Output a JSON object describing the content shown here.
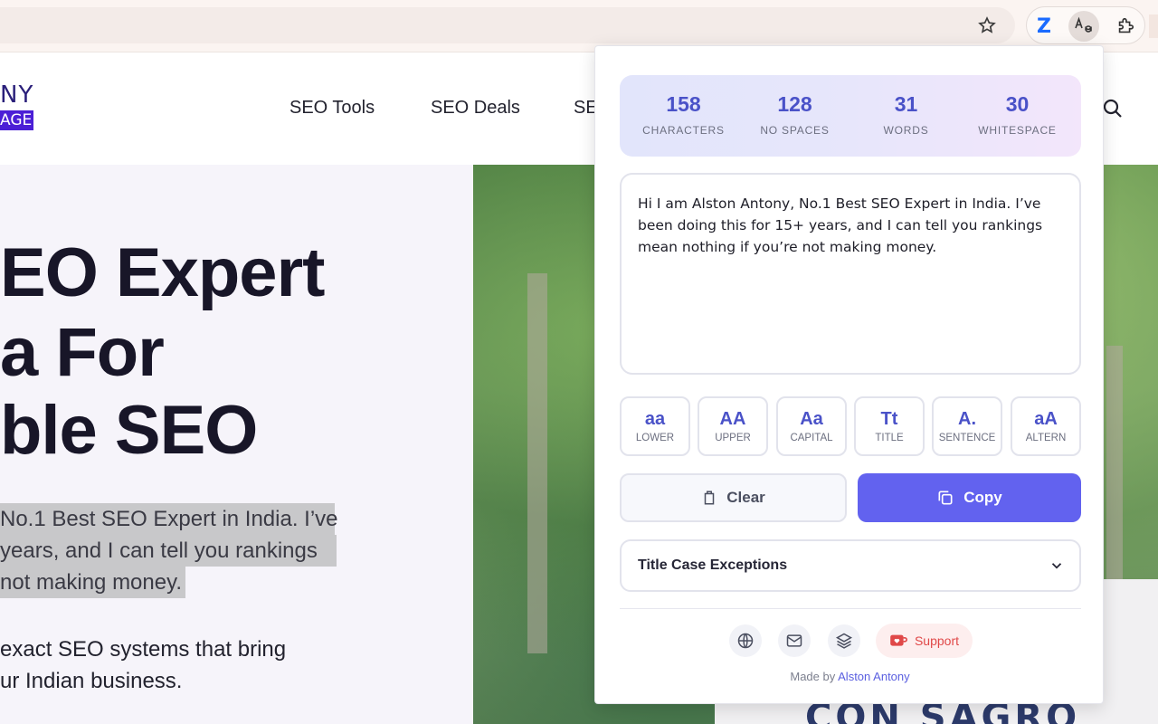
{
  "browser": {
    "star_icon": "star-icon",
    "extensions": [
      {
        "name": "zotero-extension",
        "glyph": "Z"
      },
      {
        "name": "case-converter-extension",
        "glyph": "Aa"
      },
      {
        "name": "extensions-puzzle",
        "glyph": "puzzle"
      }
    ]
  },
  "site": {
    "logo_top": "NY",
    "logo_badge": "AGE",
    "nav": [
      "SEO Tools",
      "SEO Deals",
      "SE"
    ],
    "hero_title": [
      "EO Expert",
      "a For",
      "ble SEO"
    ],
    "hero_selected_lines": [
      "No.1 Best SEO Expert in India. I’ve",
      "years, and I can tell you rankings",
      "not making money."
    ],
    "hero_body_lines": [
      "exact SEO systems that bring",
      "ur Indian business."
    ],
    "shirt_print": "CON SAGRO"
  },
  "popup": {
    "stats": [
      {
        "value": "158",
        "label": "CHARACTERS"
      },
      {
        "value": "128",
        "label": "NO SPACES"
      },
      {
        "value": "31",
        "label": "WORDS"
      },
      {
        "value": "30",
        "label": "WHITESPACE"
      }
    ],
    "text": "Hi I am Alston Antony, No.1 Best SEO Expert in India. I’ve been doing this for 15+ years, and I can tell you rankings mean nothing if you’re not making money.",
    "case_buttons": [
      {
        "glyph": "aa",
        "label": "LOWER"
      },
      {
        "glyph": "AA",
        "label": "UPPER"
      },
      {
        "glyph": "Aa",
        "label": "CAPITAL"
      },
      {
        "glyph": "Tt",
        "label": "TITLE"
      },
      {
        "glyph": "A.",
        "label": "SENTENCE"
      },
      {
        "glyph": "aA",
        "label": "ALTERN"
      }
    ],
    "clear_label": "Clear",
    "copy_label": "Copy",
    "exceptions_label": "Title Case Exceptions",
    "support_label": "Support",
    "made_by_prefix": "Made by",
    "made_by_name": "Alston Antony",
    "colors": {
      "accent": "#6262ef",
      "stat_value": "#4a52c8",
      "support": "#e04848"
    }
  }
}
